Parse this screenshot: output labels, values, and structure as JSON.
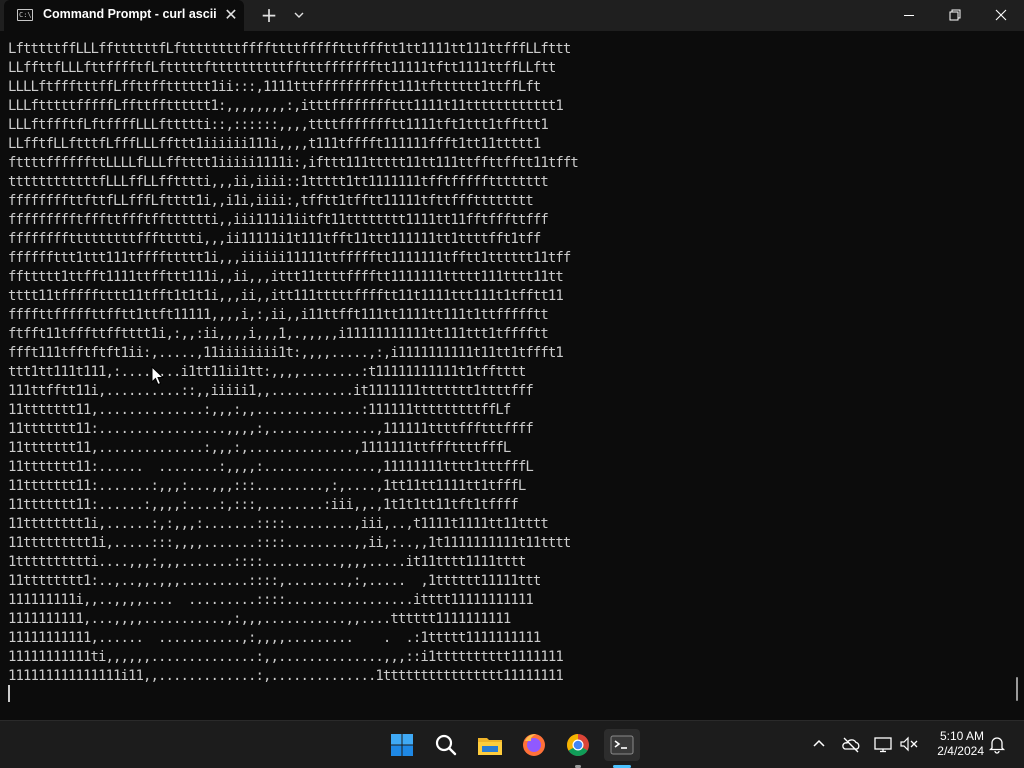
{
  "window": {
    "tab_title": "Command Prompt - curl  ascii",
    "tab_icon_text": "C:\\"
  },
  "terminal": {
    "lines": [
      "LftttttffLLLffttttttfLfttttttttffffttttffffftttffftt1tt1111tt111ttfffLLfttt",
      "LLffttfLLLfttfffftfLftttttfttttttttttfftttffffffftt11111tftt1111ttffLLftt",
      "LLLLftffftttffLffttfftttttt1ii:::,1111tttffffffffftt111tftttttt1ttffLft",
      "LLLftttttfffffLffttfftttttt1:,,,,,,,,:,itttffffffffttt1111t11tttttttttttt1",
      "LLLftffftfLftffffLLLfttttti::,::::::,,,,ttttffffffftt1111tft1ttt1tffttt1",
      "LLfftfLLftttfLfffLLLffttt1iiiiii111i,,,,t111tfffft111111ffft1tt11ttttt1",
      "fttttffffffttLLLLfLLLfftttt1iiiii1111i:,ifttt111ttttt11tt111ttffttfftt11tfft",
      "ttttttttttttfLLLffLLfftttti,,,ii,iiii::1ttttt1tt1111111tfftffffftttttttt",
      "ffffffffttfttfLLfffLftttt1i,,i1i,iiii:,tfftt1tfftt11111tfttffftttttttt",
      "ffffffffftfffttffftfftttttti,,iii111i1iitft11tttttttt1111tt11fftfffttfff",
      "fffffffftttttttttfffttttti,,,ii11111i1t111tfft11ttt111111tt1ttttfft1tff",
      "ffffffttt1ttt111tffffttttt1i,,,iiiiii11111ttffffftt1111111tfftt1tttttt11tff",
      "ffttttt1ttfft1111ttffttt111i,,ii,,,ittt11ttttfffftt1111111ttttt111tttt11tt",
      "tttt11tffffftttt11tfft1t1t1i,,,ii,,itt111tttttfffftt11t1111ttt111t1tfftt11",
      "ffffttfffffttfftt1ttft11111,,,,i,:,ii,,i11ttfft111tt1111tt111t1ttffffftt",
      "ftfft11tfffttfftttt1i,:,,:ii,,,,i,,,1,.,,,,,i11111111111tt111ttt1tfffftt",
      "ffft111tfftftft1ii:,.....,11iiiiiiii1t:,,,,.....,:,i1111111111t11tt1tffft1",
      "ttt1tt111t111,:........i1tt11ii1tt:,,,,........:t11111111111t1tfftttt",
      "111ttfftt11i,..........::,,iiiii1,,...........it1111111ttttttt1ttttfff",
      "11ttttttt11,..............:,,,:,,..............:111111tttttttttffLf",
      "11ttttttt11:.................,,,,:,..............,111111ttttffftttffff",
      "11ttttttt11,..............:,,,:,..............,1111111ttfffttttfffL",
      "11ttttttt11:......  ........:,,,,:...............,11111111tttt1tttfffL",
      "11ttttttt11:.......:,,,:...,,,:::.........,:,....,1tt11tt1111tt1tfffL",
      "11ttttttt11:......:,,,,:....:,:::,........:iii,,.,1t1t1tt11tft1tffff",
      "11tttttttt1i,......:,:,,,:.......::::.........,iii,..,t1111t1111tt11tttt",
      "11ttttttttt1i,.....:::,,,,.......::::.........,,ii,:..,,1t1111111111t11tttt",
      "1tttttttttti....,,,:,,,.......::::..........,,,,.....it11tttt1111tttt",
      "11tttttttt1:..,..,,.,,,.........::::,........,:,.....  ,1tttttt11111ttt",
      "111111111i,,..,,,,....  .........::::.................itttt11111111111",
      "1111111111,...,,,,...........,:,,,...........,,....tttttt1111111111",
      "11111111111,......  ...........,:,,,,.........    .  .:1ttttt1111111111",
      "11111111111ti,,,,,,..............:,,..............,,,::i1tttttttttt1111111",
      "111111111111111i11,,.............:,..............1tttttttttttttttt11111111"
    ]
  },
  "taskbar": {
    "time": "5:10 AM",
    "date": "2/4/2024",
    "apps": [
      "start-icon",
      "search-icon",
      "file-explorer-icon",
      "firefox-icon",
      "chrome-icon",
      "terminal-icon"
    ]
  },
  "colors": {
    "terminal_bg": "#0c0c0c",
    "terminal_fg": "#cccccc",
    "accent": "#4cc2ff",
    "taskbar_bg": "#1c1c1c"
  }
}
